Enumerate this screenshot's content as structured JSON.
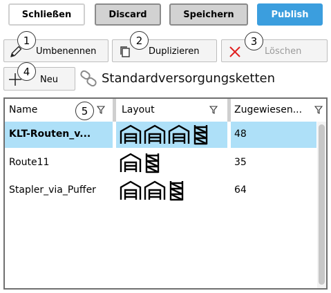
{
  "toolbar": {
    "close_label": "Schließen",
    "discard_label": "Discard",
    "save_label": "Speichern",
    "publish_label": "Publish"
  },
  "actions": {
    "rename_label": "Umbenennen",
    "duplicate_label": "Duplizieren",
    "delete_label": "Löschen",
    "new_label": "Neu"
  },
  "badges": [
    "1",
    "2",
    "3",
    "4",
    "5"
  ],
  "title": "Standardversorgungsketten",
  "table": {
    "columns": [
      "Name",
      "Layout",
      "Zugewiesen..."
    ],
    "rows": [
      {
        "name": "KLT-Routen_v...",
        "layout": [
          "warehouse-icon",
          "warehouse-icon",
          "warehouse-icon",
          "rack-icon"
        ],
        "assigned": "48",
        "selected": true
      },
      {
        "name": "Route11",
        "layout": [
          "warehouse-icon",
          "rack-icon"
        ],
        "assigned": "35",
        "selected": false
      },
      {
        "name": "Stapler_via_Puffer",
        "layout": [
          "warehouse-icon",
          "warehouse-icon",
          "rack-icon"
        ],
        "assigned": "64",
        "selected": false
      }
    ]
  },
  "colors": {
    "publish": "#3b9ede",
    "selected_row": "#aee0f8",
    "delete_x": "#e02020"
  }
}
